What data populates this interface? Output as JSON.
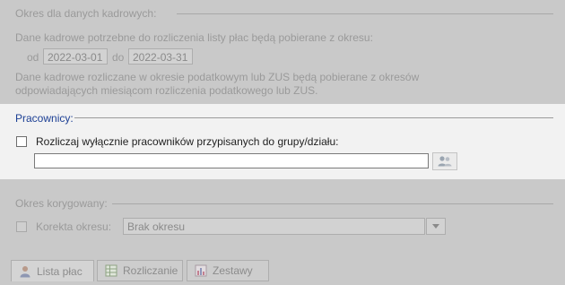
{
  "period_section": {
    "title": "Okres dla danych kadrowych:",
    "info_line": "Dane kadrowe potrzebne do rozliczenia listy płac będą pobierane z okresu:",
    "from_label": "od",
    "from_value": "2022-03-01",
    "to_label": "do",
    "to_value": "2022-03-31",
    "note_line1": "Dane kadrowe rozliczane w okresie podatkowym lub ZUS będą pobierane z okresów",
    "note_line2": "odpowiadających miesiącom rozliczenia podatkowego lub ZUS."
  },
  "employees_section": {
    "title": "Pracownicy:",
    "checkbox_label": "Rozliczaj wyłącznie pracowników przypisanych do grupy/działu:",
    "checkbox_checked": false,
    "group_value": ""
  },
  "correction_section": {
    "title": "Okres korygowany:",
    "checkbox_label": "Korekta okresu:",
    "select_value": "Brak okresu"
  },
  "tabs": [
    {
      "label": "Lista płac",
      "icon": "person-icon"
    },
    {
      "label": "Rozliczanie",
      "icon": "table-icon"
    },
    {
      "label": "Zestawy",
      "icon": "report-icon"
    }
  ],
  "colors": {
    "active_title": "#1c3f94",
    "dim_text": "#9a9a9a",
    "overlay_bg": "#c9c9c9"
  }
}
